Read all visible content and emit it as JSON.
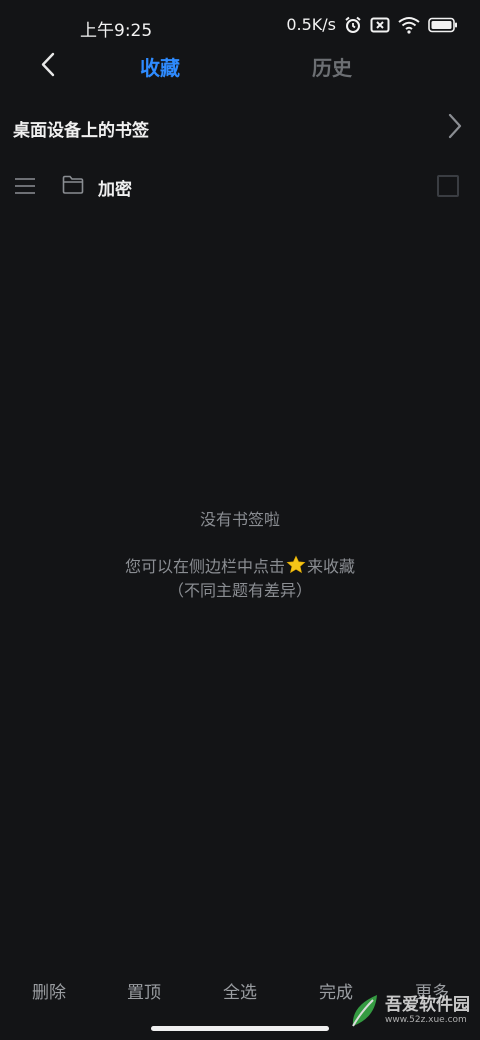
{
  "status_bar": {
    "time": "上午9:25",
    "network_speed": "0.5K/s",
    "icons": [
      "alarm-icon",
      "sim-off-icon",
      "wifi-icon",
      "battery-icon"
    ]
  },
  "header": {
    "back_icon": "chevron-left-icon",
    "tabs": [
      {
        "label": "收藏",
        "active": true
      },
      {
        "label": "历史",
        "active": false
      }
    ]
  },
  "bookmarks": {
    "desktop_row": {
      "label": "桌面设备上的书签"
    },
    "folder_row": {
      "label": "加密"
    }
  },
  "empty_state": {
    "title": "没有书签啦",
    "hint_before_star": "您可以在侧边栏中点击",
    "hint_after_star": "来收藏",
    "hint_note": "（不同主题有差异）"
  },
  "bottom_bar": {
    "delete_label": "删除",
    "pin_label": "置顶",
    "select_all_label": "全选",
    "done_label": "完成",
    "more_label": "更多"
  },
  "watermark": {
    "main": "吾爱软件园",
    "sub": "www.52z.xue.com"
  },
  "colors": {
    "background": "#131416",
    "accent": "#2e8bff",
    "inactive_tab": "#6c6f73",
    "muted_text": "#8a8d92",
    "star": "#f5c518"
  }
}
